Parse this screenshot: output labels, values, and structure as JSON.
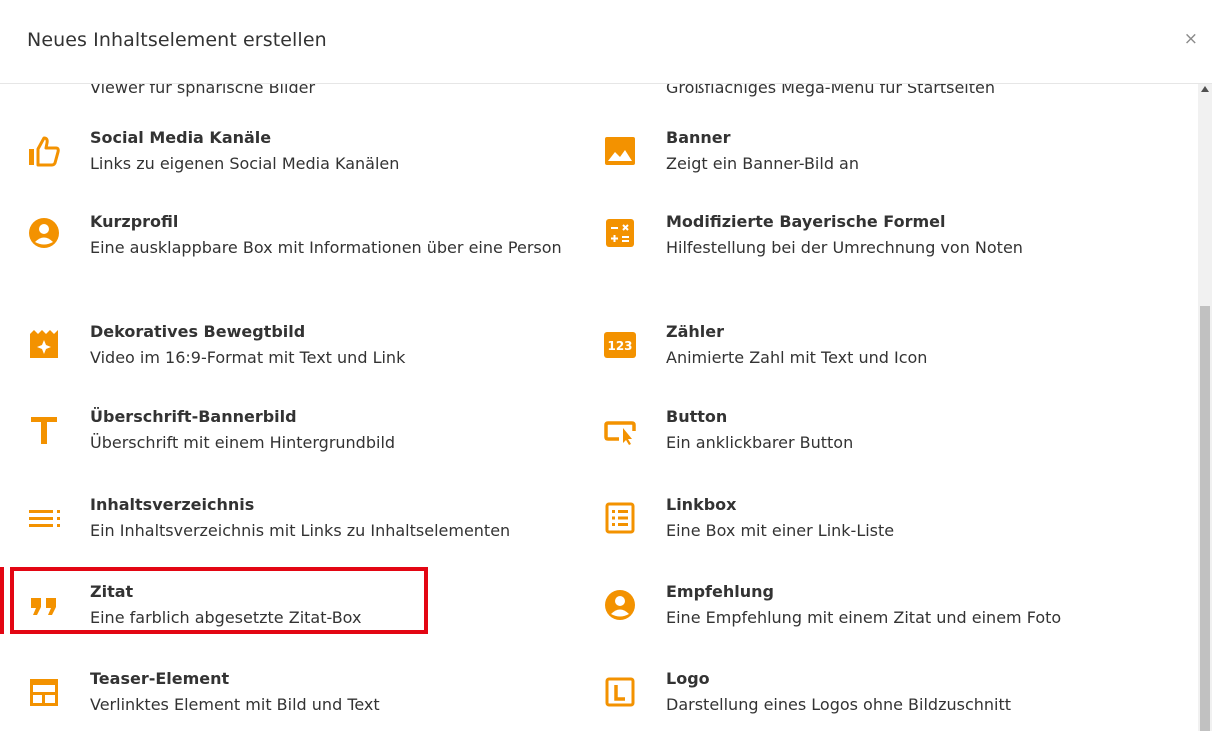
{
  "dialog": {
    "title": "Neues Inhaltselement erstellen",
    "close": "×"
  },
  "accent_color": "#f39200",
  "highlight_color": "#e30613",
  "items": [
    {
      "title": "",
      "description": "Viewer für sphärische Bilder",
      "icon": "sphere-viewer-icon"
    },
    {
      "title": "",
      "description": "Großflächiges Mega-Menü für Startseiten",
      "icon": "mega-menu-icon"
    },
    {
      "title": "Social Media Kanäle",
      "description": "Links zu eigenen Social Media Kanälen",
      "icon": "thumbs-up-icon"
    },
    {
      "title": "Banner",
      "description": "Zeigt ein Banner-Bild an",
      "icon": "image-icon"
    },
    {
      "title": "Kurzprofil",
      "description": "Eine ausklappbare Box mit Informationen über eine Person",
      "icon": "user-circle-icon"
    },
    {
      "title": "Modifizierte Bayerische Formel",
      "description": "Hilfestellung bei der Umrechnung von Noten",
      "icon": "calculator-icon"
    },
    {
      "title": "Dekoratives Bewegtbild",
      "description": "Video im 16:9-Format mit Text und Link",
      "icon": "video-sparkle-icon"
    },
    {
      "title": "Zähler",
      "description": "Animierte Zahl mit Text und Icon",
      "icon": "counter-123-icon",
      "icon_text": "123"
    },
    {
      "title": "Überschrift-Bannerbild",
      "description": "Überschrift mit einem Hintergrundbild",
      "icon": "heading-t-icon"
    },
    {
      "title": "Button",
      "description": "Ein anklickbarer Button",
      "icon": "button-click-icon"
    },
    {
      "title": "Inhaltsverzeichnis",
      "description": "Ein Inhaltsverzeichnis mit Links zu Inhaltselementen",
      "icon": "list-lines-icon"
    },
    {
      "title": "Linkbox",
      "description": "Eine Box mit einer Link-Liste",
      "icon": "list-box-icon"
    },
    {
      "title": "Zitat",
      "description": "Eine farblich abgesetzte Zitat-Box",
      "icon": "quote-icon"
    },
    {
      "title": "Empfehlung",
      "description": "Eine Empfehlung mit einem Zitat und einem Foto",
      "icon": "user-circle-icon"
    },
    {
      "title": "Teaser-Element",
      "description": "Verlinktes Element mit Bild und Text",
      "icon": "teaser-layout-icon"
    },
    {
      "title": "Logo",
      "description": "Darstellung eines Logos ohne Bildzuschnitt",
      "icon": "logo-l-icon"
    }
  ]
}
